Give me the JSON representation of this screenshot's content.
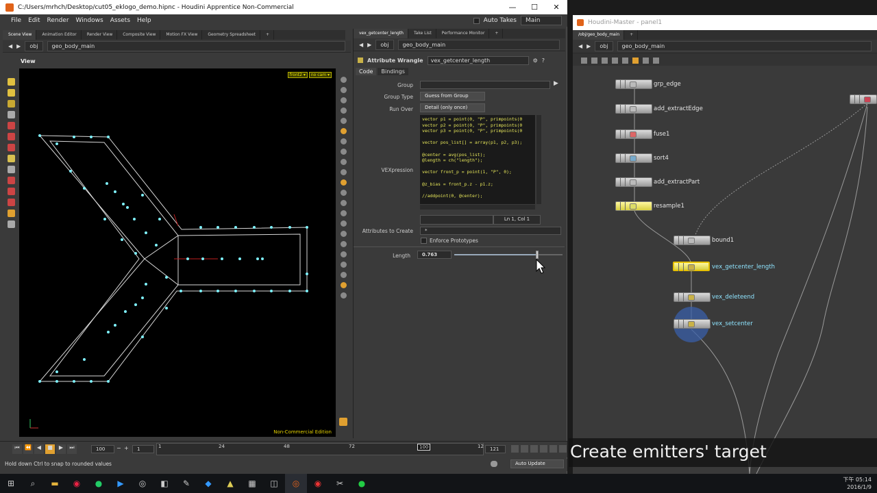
{
  "title_bar": {
    "path": "C:/Users/mrhch/Desktop/cut05_eklogo_demo.hipnc - Houdini Apprentice Non-Commercial",
    "minimize": "—",
    "maximize": "☐",
    "close": "✕"
  },
  "menu": {
    "items": [
      "File",
      "Edit",
      "Render",
      "Windows",
      "Assets",
      "Help"
    ],
    "auto_takes": "Auto Takes",
    "desktop": "Main"
  },
  "left_tabs": [
    "Scene View",
    "Animation Editor",
    "Render View",
    "Composite View",
    "Motion FX View",
    "Geometry Spreadsheet"
  ],
  "left_path": {
    "obj": "obj",
    "node": "geo_body_main"
  },
  "viewport": {
    "title": "View",
    "camera": "front2 ▾",
    "cam": "no cam ▾",
    "watermark": "Non-Commercial Edition"
  },
  "param_tabs": [
    "vex_getcenter_length",
    "Take List",
    "Performance Monitor"
  ],
  "param_path": {
    "obj": "obj",
    "node": "geo_body_main"
  },
  "param_header": {
    "type": "Attribute Wrangle",
    "name": "vex_getcenter_length"
  },
  "param_subtabs": [
    "Code",
    "Bindings"
  ],
  "params": {
    "group_label": "Group",
    "group_value": "",
    "group_type_label": "Group Type",
    "group_type_value": "Guess from Group",
    "run_over_label": "Run Over",
    "run_over_value": "Detail (only once)",
    "vexpression_label": "VEXpression",
    "code": "vector p1 = point(0, \"P\", primpoints(0\nvector p2 = point(0, \"P\", primpoints(0\nvector p3 = point(0, \"P\", primpoints(0\n\nvector pos_list[] = array(p1, p2, p3);\n\n@center = avg(pos_list);\n@length = ch(\"length\");\n\nvector front_p = point(1, \"P\", 0);\n\n@z_bias = front_p.z - p1.z;\n\n//addpoint(0, @center);",
    "cursor_pos": "Ln 1, Col 1",
    "attrs_label": "Attributes to Create",
    "attrs_value": "*",
    "enforce_label": "Enforce Prototypes",
    "length_label": "Length",
    "length_value": "0.763",
    "length_fraction": 0.763
  },
  "timeline": {
    "start": "100",
    "step": "1",
    "ticks": [
      "1",
      "24",
      "48",
      "72",
      "12"
    ],
    "current": "100",
    "end": "121"
  },
  "status": {
    "hint": "Hold down Ctrl to snap to rounded values",
    "auto_update": "Auto Update"
  },
  "network": {
    "title": "Houdini-Master - panel1",
    "tab": "/obj/geo_body_main",
    "path_obj": "obj",
    "path_node": "geo_body_main",
    "nodes": [
      {
        "name": "grp_edge",
        "color": "#cfcfcf"
      },
      {
        "name": "add_extractEdge",
        "color": "#cfcfcf"
      },
      {
        "name": "fuse1",
        "color": "#cfcfcf"
      },
      {
        "name": "sort4",
        "color": "#cfcfcf"
      },
      {
        "name": "add_extractPart",
        "color": "#cfcfcf"
      },
      {
        "name": "resample1",
        "color": "#e8e070"
      },
      {
        "name": "bound1",
        "color": "#cfcfcf"
      },
      {
        "name": "vex_getcenter_length",
        "color": "#e8e070"
      },
      {
        "name": "vex_deleteend",
        "color": "#cfcfcf"
      },
      {
        "name": "vex_setcenter",
        "color": "#cfcfcf"
      }
    ]
  },
  "overlay": {
    "caption": "Create emitters' target"
  },
  "taskbar": {
    "time": "下午 05:14",
    "date": "2016/1/9"
  },
  "colors": {
    "accent_yellow": "#e8e200",
    "viewport_bg": "#000000",
    "point_cyan": "#7ff3ff"
  }
}
